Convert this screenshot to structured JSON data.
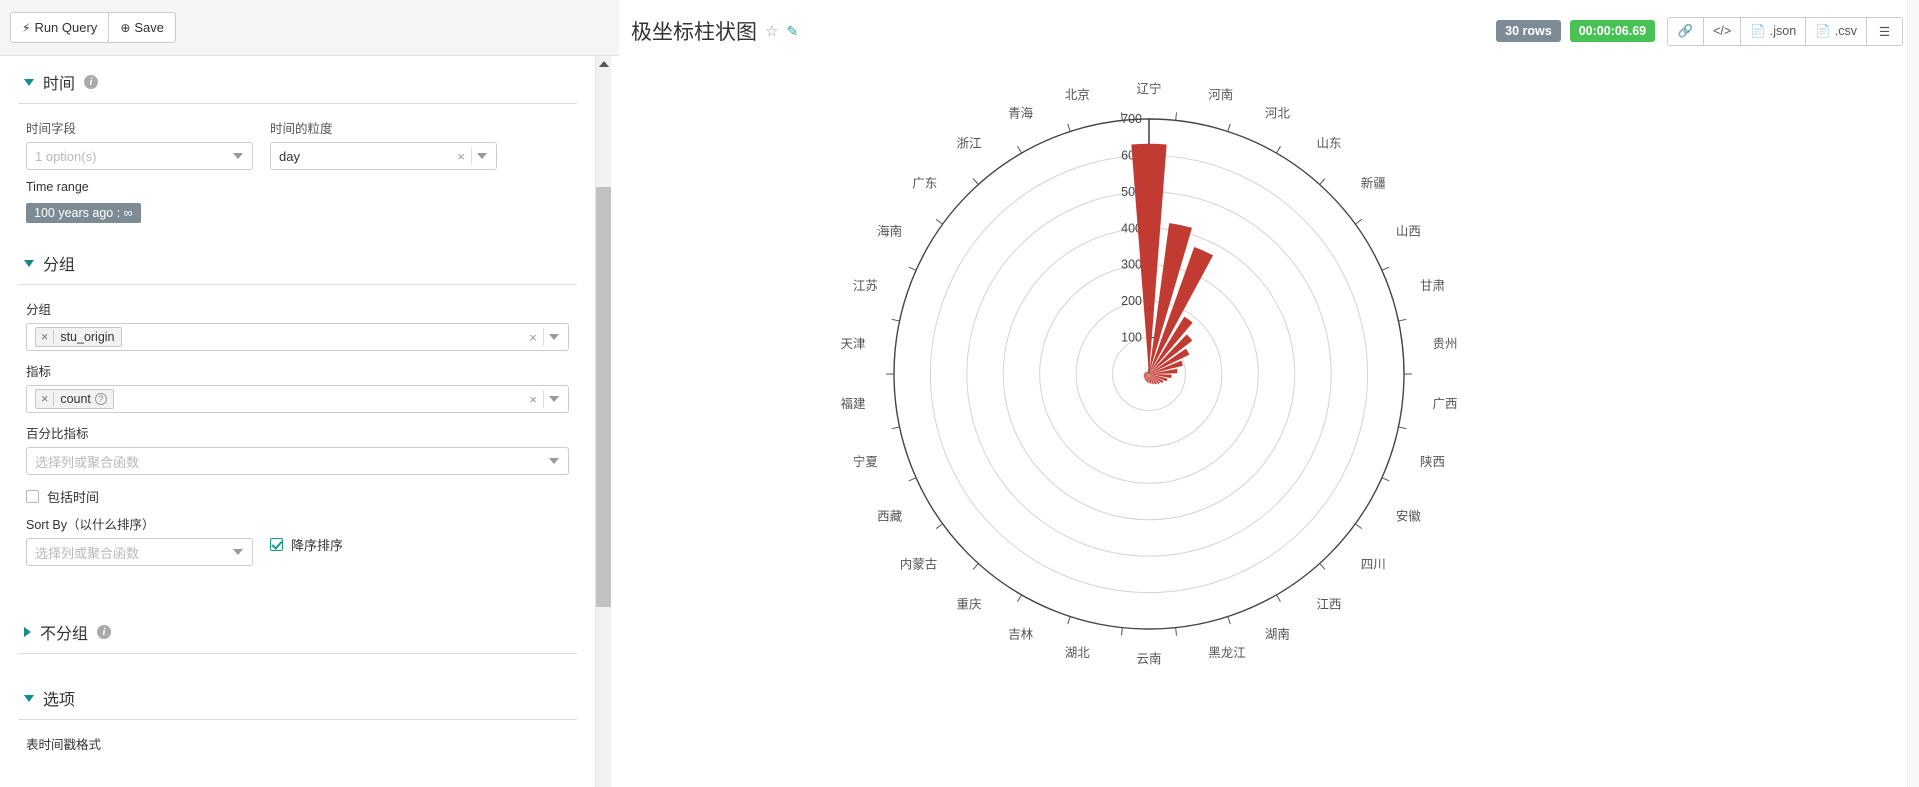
{
  "toolbar": {
    "run_query_label": "Run Query",
    "run_query_icon": "bolt-icon",
    "save_label": "Save",
    "save_icon": "plus-circle-icon"
  },
  "panel": {
    "sections": [
      {
        "key": "time",
        "title": "时间",
        "expanded": true,
        "has_info": true
      },
      {
        "key": "groupby",
        "title": "分组",
        "expanded": true,
        "has_info": false
      },
      {
        "key": "nogroup",
        "title": "不分组",
        "expanded": false,
        "has_info": true
      },
      {
        "key": "options",
        "title": "选项",
        "expanded": true,
        "has_info": false
      }
    ],
    "time": {
      "field_label": "时间字段",
      "field_value": "1 option(s)",
      "grain_label": "时间的粒度",
      "grain_value": "day",
      "time_range_label": "Time range",
      "time_range_value": "100 years ago : ∞"
    },
    "groupby": {
      "group_label": "分组",
      "group_token": "stu_origin",
      "metric_label": "指标",
      "metric_token": "count",
      "percent_label": "百分比指标",
      "percent_placeholder": "选择列或聚合函数",
      "include_time_label": "包括时间",
      "include_time_checked": false,
      "sort_by_label": "Sort By（以什么排序）",
      "sort_by_placeholder": "选择列或聚合函数",
      "desc_label": "降序排序",
      "desc_checked": true
    },
    "options": {
      "table_ts_label": "表时间戳格式"
    }
  },
  "chart_header": {
    "title": "极坐标柱状图",
    "star_icon": "star-outline-icon",
    "edit_icon": "edit-square-icon",
    "rows_badge": "30 rows",
    "time_badge": "00:00:06.69",
    "buttons": [
      {
        "name": "link-button",
        "icon": "link-icon",
        "label": ""
      },
      {
        "name": "code-button",
        "icon": "code-icon",
        "label": ""
      },
      {
        "name": "json-button",
        "icon": "file-icon",
        "label": ".json"
      },
      {
        "name": "csv-button",
        "icon": "file-icon",
        "label": ".csv"
      },
      {
        "name": "menu-button",
        "icon": "hamburger-icon",
        "label": ""
      }
    ]
  },
  "chart_data": {
    "type": "bar",
    "subtype": "polar-bar",
    "title": "极坐标柱状图",
    "xlabel": "",
    "ylabel": "",
    "grid": true,
    "legend": false,
    "rlim": [
      0,
      700
    ],
    "rticks": [
      100,
      200,
      300,
      400,
      500,
      600,
      700
    ],
    "bar_color": "#c23b33",
    "categories": [
      "辽宁",
      "河南",
      "河北",
      "山东",
      "新疆",
      "山西",
      "甘肃",
      "贵州",
      "广西",
      "陕西",
      "安徽",
      "四川",
      "江西",
      "湖南",
      "黑龙江",
      "云南",
      "湖北",
      "吉林",
      "重庆",
      "内蒙古",
      "西藏",
      "宁夏",
      "福建",
      "天津",
      "江苏",
      "海南",
      "广东",
      "浙江",
      "青海",
      "北京"
    ],
    "values": [
      632,
      418,
      370,
      185,
      150,
      123,
      96,
      78,
      62,
      52,
      44,
      38,
      34,
      30,
      27,
      25,
      23,
      21,
      19,
      17,
      16,
      15,
      14,
      13,
      12,
      11,
      10,
      9,
      8,
      7
    ]
  }
}
